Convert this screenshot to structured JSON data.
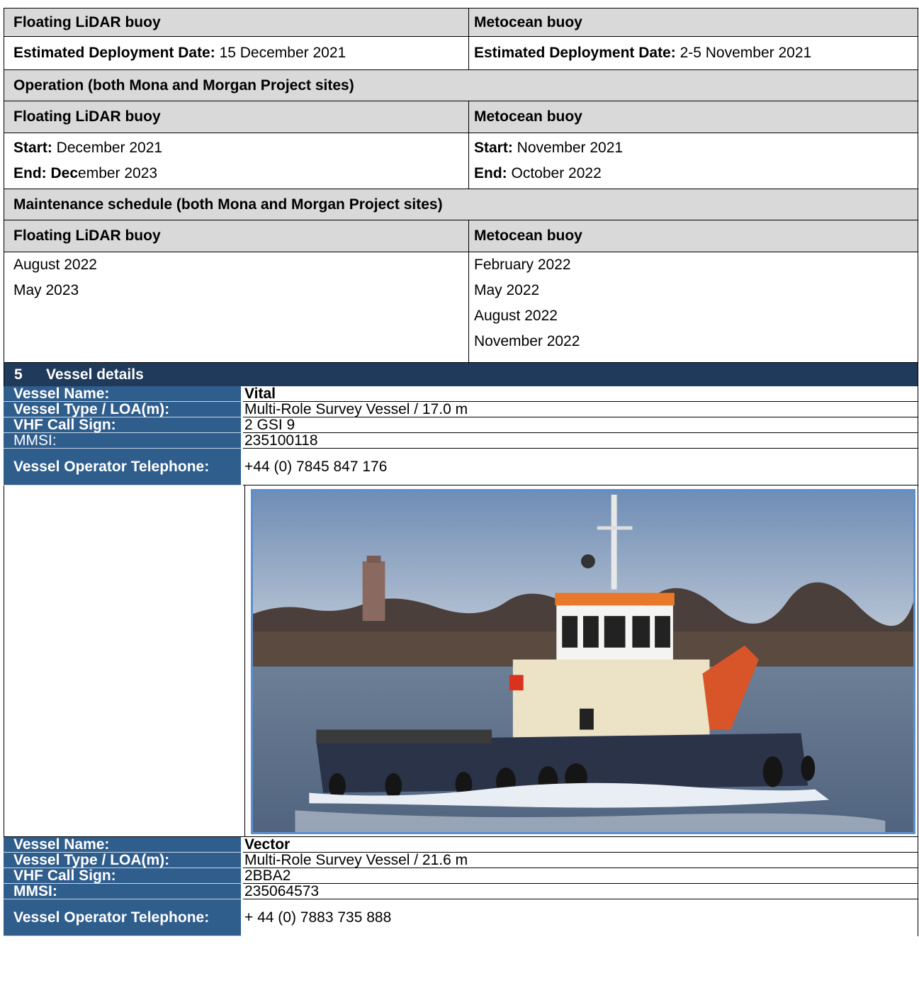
{
  "deployment": {
    "left_title": "Floating LiDAR buoy",
    "right_title": "Metocean buoy",
    "left_label": "Estimated Deployment Date:",
    "left_value": " 15 December 2021",
    "right_label": "Estimated Deployment Date:",
    "right_value": " 2-5 November 2021"
  },
  "operation": {
    "heading": "Operation (both Mona and Morgan Project sites)",
    "left_title": "Floating LiDAR buoy",
    "right_title": "Metocean buoy",
    "left_start_label": "Start:",
    "left_start_value": " December 2021",
    "left_end_label": "End: Dec",
    "left_end_value": "ember 2023",
    "right_start_label": "Start:",
    "right_start_value": " November 2021",
    "right_end_label": "End:",
    "right_end_value": " October 2022"
  },
  "maintenance": {
    "heading": "Maintenance schedule (both Mona and Morgan Project sites)",
    "left_title": "Floating LiDAR buoy",
    "right_title": "Metocean buoy",
    "left_dates": [
      "August 2022",
      "May 2023"
    ],
    "right_dates": [
      "February 2022",
      "May 2022",
      "August 2022",
      "November 2022"
    ]
  },
  "vessel_section": {
    "number": "5",
    "title": "Vessel details"
  },
  "vessel1": {
    "name_label": "Vessel Name:",
    "name": "Vital",
    "type_label": "Vessel Type / LOA(m):",
    "type": "Multi-Role Survey Vessel / 17.0 m",
    "vhf_label": "VHF Call Sign:",
    "vhf": "2 GSI 9",
    "mmsi_label": "MMSI:",
    "mmsi": "235100118",
    "phone_label": "Vessel Operator Telephone:",
    "phone": "+44 (0) 7845 847 176"
  },
  "vessel2": {
    "name_label": "Vessel Name:",
    "name": "Vector",
    "type_label": "Vessel Type / LOA(m):",
    "type": "Multi-Role Survey Vessel / 21.6 m",
    "vhf_label": "VHF Call Sign:",
    "vhf": "2BBA2",
    "mmsi_label": "MMSI:",
    "mmsi": "235064573",
    "phone_label": "Vessel Operator Telephone:",
    "phone": "+ 44 (0) 7883 735 888"
  },
  "colors": {
    "header_grey": "#d9d9d9",
    "section_navy": "#1f3a5a",
    "label_blue": "#2f5d8c",
    "photo_border": "#5b8fd0"
  }
}
